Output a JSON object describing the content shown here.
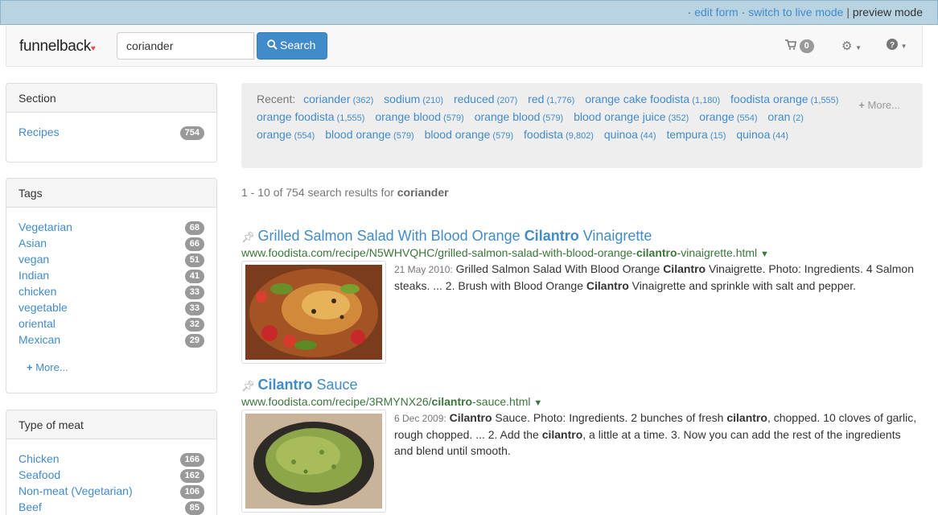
{
  "adminbar": {
    "edit_form": "edit form",
    "switch_live": "switch to live mode",
    "preview_mode": "preview mode"
  },
  "nav": {
    "brand": "funnelback",
    "search_value": "coriander",
    "search_button": "Search",
    "cart_count": "0"
  },
  "facets": {
    "section": {
      "title": "Section",
      "items": [
        {
          "label": "Recipes",
          "count": "754"
        }
      ]
    },
    "tags": {
      "title": "Tags",
      "items": [
        {
          "label": "Vegetarian",
          "count": "68"
        },
        {
          "label": "Asian",
          "count": "66"
        },
        {
          "label": "vegan",
          "count": "51"
        },
        {
          "label": "Indian",
          "count": "41"
        },
        {
          "label": "chicken",
          "count": "33"
        },
        {
          "label": "vegetable",
          "count": "33"
        },
        {
          "label": "oriental",
          "count": "32"
        },
        {
          "label": "Mexican",
          "count": "29"
        }
      ],
      "more": "More..."
    },
    "meat": {
      "title": "Type of meat",
      "items": [
        {
          "label": "Chicken",
          "count": "166"
        },
        {
          "label": "Seafood",
          "count": "162"
        },
        {
          "label": "Non-meat (Vegetarian)",
          "count": "106"
        },
        {
          "label": "Beef",
          "count": "85"
        }
      ]
    }
  },
  "recent": {
    "label": "Recent:",
    "more": "More...",
    "queries": [
      {
        "q": "coriander",
        "n": "(362)"
      },
      {
        "q": "sodium",
        "n": "(210)"
      },
      {
        "q": "reduced",
        "n": "(207)"
      },
      {
        "q": "red",
        "n": "(1,776)"
      },
      {
        "q": "orange cake foodista",
        "n": "(1,180)"
      },
      {
        "q": "foodista orange",
        "n": "(1,555)"
      },
      {
        "q": "orange foodista",
        "n": "(1,555)"
      },
      {
        "q": "orange blood",
        "n": "(579)"
      },
      {
        "q": "orange blood",
        "n": "(579)"
      },
      {
        "q": "blood orange juice",
        "n": "(352)"
      },
      {
        "q": "orange",
        "n": "(554)"
      },
      {
        "q": "oran",
        "n": "(2)"
      },
      {
        "q": "orange",
        "n": "(554)"
      },
      {
        "q": "blood orange",
        "n": "(579)"
      },
      {
        "q": "blood orange",
        "n": "(579)"
      },
      {
        "q": "foodista",
        "n": "(9,802)"
      },
      {
        "q": "quinoa",
        "n": "(44)"
      },
      {
        "q": "tempura",
        "n": "(15)"
      },
      {
        "q": "quinoa",
        "n": "(44)"
      }
    ]
  },
  "results_count": {
    "prefix": "1 - 10 of 754 search results for",
    "query": "coriander"
  },
  "results": [
    {
      "title_a": "Grilled Salmon Salad With Blood Orange ",
      "title_b": "Cilantro",
      "title_c": " Vinaigrette",
      "url_a": "www.foodista.com/recipe/N5WHVQHC/grilled-salmon-salad-with-blood-orange-",
      "url_b": "cilantro",
      "url_c": "-vinaigrette.html",
      "date": "21 May 2010:",
      "sum_1": " Grilled Salmon Salad With Blood Orange ",
      "sum_2": "Cilantro",
      "sum_3": " Vinaigrette. Photo: Ingredients. 4 Salmon steaks. ... 2. Brush with Blood Orange ",
      "sum_4": "Cilantro",
      "sum_5": " Vinaigrette and sprinkle with salt and pepper."
    },
    {
      "title_a": "",
      "title_b": "Cilantro",
      "title_c": " Sauce",
      "url_a": "www.foodista.com/recipe/3RMYNX26/",
      "url_b": "cilantro",
      "url_c": "-sauce.html",
      "date": "6 Dec 2009:",
      "sum_1": " ",
      "sum_2": "Cilantro",
      "sum_3": " Sauce. Photo: Ingredients. 2 bunches of fresh ",
      "sum_4": "cilantro",
      "sum_5": ", chopped. 10 cloves of garlic, rough chopped. ... 2. Add the ",
      "sum_6": "cilantro",
      "sum_7": ", a little at a time. 3. Now you can add the rest of the ingredients and blend until smooth."
    }
  ]
}
